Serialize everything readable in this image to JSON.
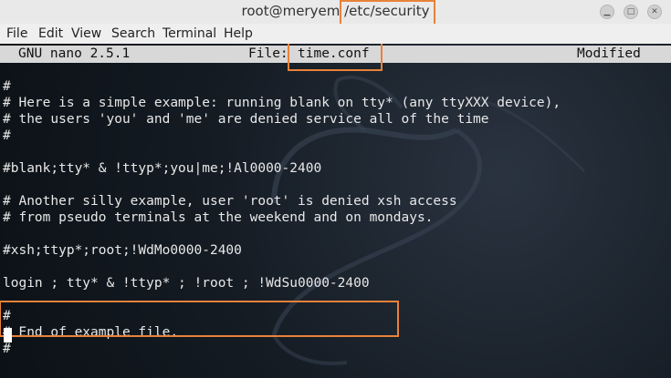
{
  "window": {
    "title_user": "root@meryem",
    "title_path": "/etc/security"
  },
  "menu": [
    "File",
    "Edit",
    "View",
    "Search",
    "Terminal",
    "Help"
  ],
  "nano": {
    "version": "GNU nano 2.5.1",
    "file_label": "File:",
    "file_name": "time.conf",
    "status": "Modified"
  },
  "lines": [
    "#",
    "# Here is a simple example: running blank on tty* (any ttyXXX device),",
    "# the users 'you' and 'me' are denied service all of the time",
    "#",
    "",
    "#blank;tty* & !ttyp*;you|me;!Al0000-2400",
    "",
    "# Another silly example, user 'root' is denied xsh access",
    "# from pseudo terminals at the weekend and on mondays.",
    "",
    "#xsh;ttyp*;root;!WdMo0000-2400",
    "",
    "login ; tty* & !ttyp* ; !root ; !WdSu0000-2400",
    "",
    "#",
    "# End of example file.",
    "#"
  ],
  "colors": {
    "highlight": "#e8823a",
    "terminal_bg": "#141b23",
    "text": "#e8e8e8"
  }
}
